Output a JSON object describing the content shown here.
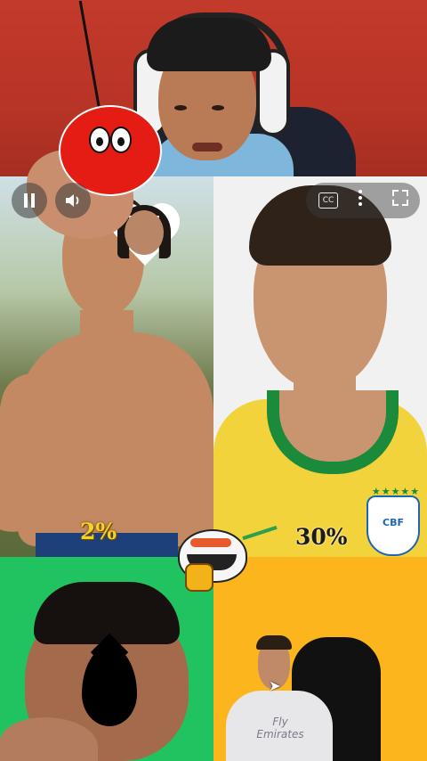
{
  "webcam": {
    "label": "streamer-webcam"
  },
  "panels": {
    "top_left": {
      "percent": "2%"
    },
    "top_right": {
      "percent": "30%",
      "badge": "CBF"
    }
  },
  "controls": {
    "pause_icon": "pause-icon",
    "volume_icon": "volume-icon",
    "cc_label": "CC",
    "more_icon": "more-vertical-icon",
    "fullscreen_icon": "fullscreen-icon"
  },
  "bottom_right": {
    "shirt_text": "Fly Emirates"
  },
  "colors": {
    "webcam_bg": "#c23a2b",
    "mbappe_bg": "#21c361",
    "cr7_bg": "#fdb51e",
    "pct_yellow": "#f5d22b"
  }
}
